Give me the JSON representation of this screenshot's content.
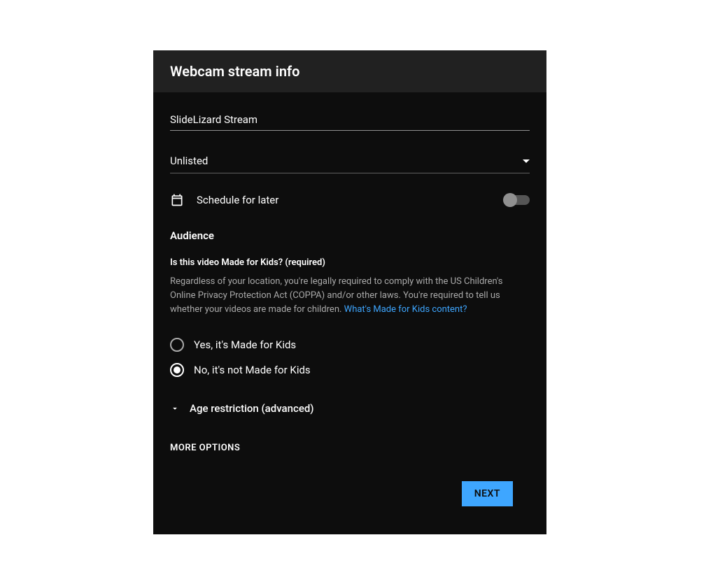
{
  "dialog": {
    "title": "Webcam stream info",
    "stream_title_value": "SlideLizard Stream",
    "visibility": {
      "selected": "Unlisted"
    },
    "schedule": {
      "label": "Schedule for later",
      "enabled": false
    },
    "audience": {
      "heading": "Audience",
      "question": "Is this video Made for Kids? (required)",
      "description": "Regardless of your location, you're legally required to comply with the US Children's Online Privacy Protection Act (COPPA) and/or other laws. You're required to tell us whether your videos are made for children. ",
      "link_text": "What's Made for Kids content?",
      "options": [
        {
          "label": "Yes, it's Made for Kids",
          "selected": false
        },
        {
          "label": "No, it's not Made for Kids",
          "selected": true
        }
      ]
    },
    "age_restriction_label": "Age restriction (advanced)",
    "more_options_label": "MORE OPTIONS",
    "next_button_label": "NEXT"
  }
}
